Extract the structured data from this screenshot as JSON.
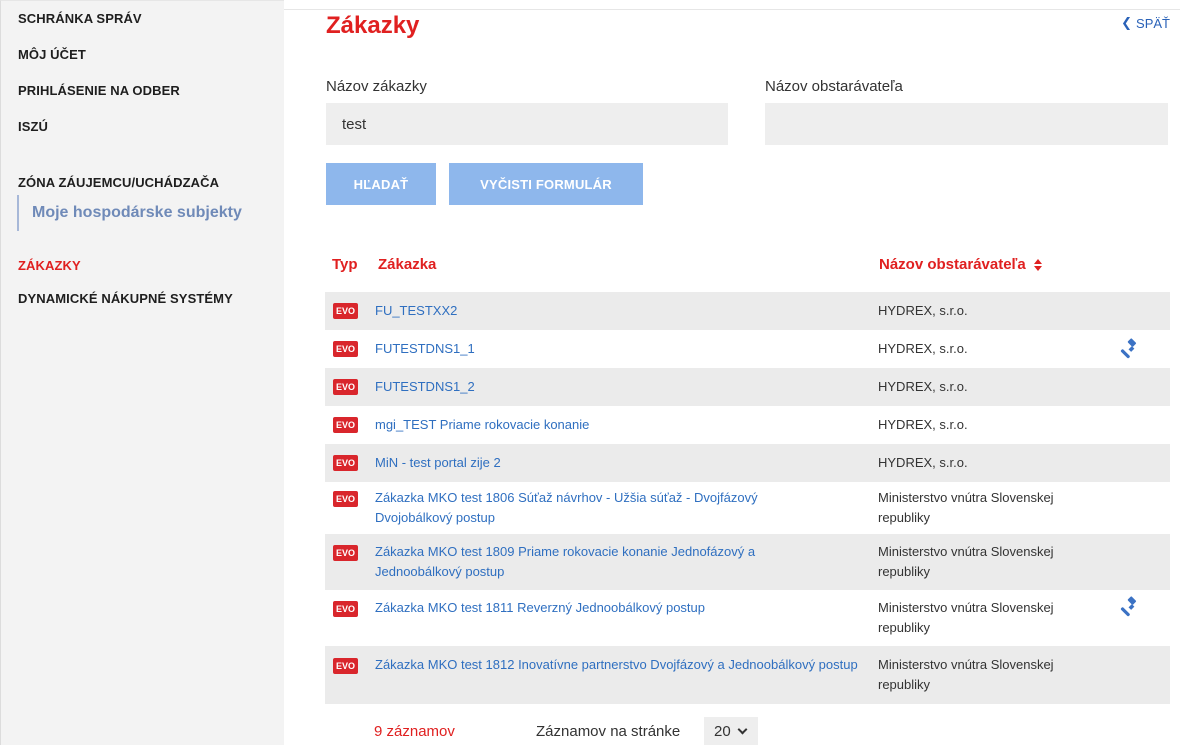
{
  "sidebar": {
    "items": [
      {
        "label": "SCHRÁNKA SPRÁV"
      },
      {
        "label": "MÔJ ÚČET"
      },
      {
        "label": "PRIHLÁSENIE NA ODBER"
      },
      {
        "label": "ISZÚ"
      },
      {
        "label": "ZÓNA ZÁUJEMCU/UCHÁDZAČA"
      },
      {
        "label": "Moje hospodárske subjekty"
      },
      {
        "label": "ZÁKAZKY"
      },
      {
        "label": "DYNAMICKÉ NÁKUPNÉ SYSTÉMY"
      }
    ],
    "active_item": "ZÁKAZKY"
  },
  "header": {
    "title": "Zákazky",
    "back_label": "SPÄŤ"
  },
  "form": {
    "nazov_zakazky_label": "Názov zákazky",
    "nazov_zakazky_value": "test",
    "nazov_obstaravatela_label": "Názov obstarávateľa",
    "nazov_obstaravatela_value": "",
    "search_button": "HĽADAŤ",
    "clear_button": "VYČISTI FORMULÁR"
  },
  "table": {
    "headers": {
      "typ": "Typ",
      "zakazka": "Zákazka",
      "obstaravatel": "Názov obstarávateľa"
    },
    "rows": [
      {
        "typ": "EVO",
        "zakazka": "FU_TESTXX2",
        "obstaravatel": "HYDREX, s.r.o.",
        "gavel": false
      },
      {
        "typ": "EVO",
        "zakazka": "FUTESTDNS1_1",
        "obstaravatel": "HYDREX, s.r.o.",
        "gavel": true
      },
      {
        "typ": "EVO",
        "zakazka": "FUTESTDNS1_2",
        "obstaravatel": "HYDREX, s.r.o.",
        "gavel": false
      },
      {
        "typ": "EVO",
        "zakazka": "mgi_TEST Priame rokovacie konanie",
        "obstaravatel": "HYDREX, s.r.o.",
        "gavel": false
      },
      {
        "typ": "EVO",
        "zakazka": "MiN - test portal zije 2",
        "obstaravatel": "HYDREX, s.r.o.",
        "gavel": false
      },
      {
        "typ": "EVO",
        "zakazka": "Zákazka MKO test 1806 Súťaž návrhov - Užšia súťaž - Dvojfázový Dvojobálkový postup",
        "obstaravatel": "Ministerstvo vnútra Slovenskej republiky",
        "gavel": false
      },
      {
        "typ": "EVO",
        "zakazka": "Zákazka MKO test 1809 Priame rokovacie konanie Jednofázový a Jednoobálkový postup",
        "obstaravatel": "Ministerstvo vnútra Slovenskej republiky",
        "gavel": false
      },
      {
        "typ": "EVO",
        "zakazka": "Zákazka MKO test 1811 Reverzný Jednoobálkový postup",
        "obstaravatel": "Ministerstvo vnútra Slovenskej republiky",
        "gavel": true
      },
      {
        "typ": "EVO",
        "zakazka": "Zákazka MKO test 1812 Inovatívne partnerstvo Dvojfázový a Jednoobálkový postup",
        "obstaravatel": "Ministerstvo vnútra Slovenskej republiky",
        "gavel": false
      }
    ]
  },
  "footer": {
    "count_text": "9 záznamov",
    "per_page_label": "Záznamov na stránke",
    "per_page_value": "20"
  },
  "colors": {
    "accent_red": "#e02020",
    "link_blue": "#2f6fc0",
    "button_blue": "#8eb7ec",
    "badge_red": "#d9262c"
  }
}
